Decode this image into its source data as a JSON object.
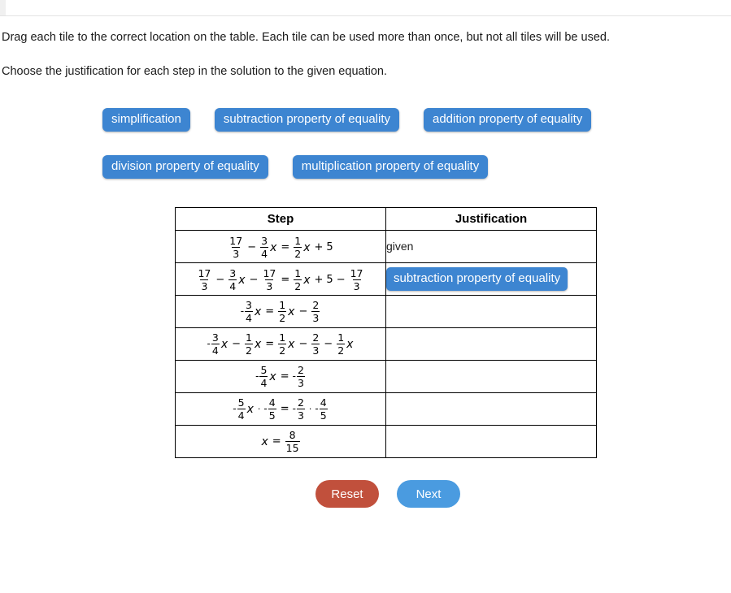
{
  "instructions": {
    "line1": "Drag each tile to the correct location on the table. Each tile can be used more than once, but not all tiles will be used.",
    "line2": "Choose the justification for each step in the solution to the given equation."
  },
  "colors": {
    "tile_blue": "#3d85d1",
    "reset_red": "#c1503c",
    "next_blue": "#4a9be0",
    "table_border": "#000000"
  },
  "tile_tray": {
    "row1": [
      {
        "label": "simplification"
      },
      {
        "label": "subtraction property of equality"
      },
      {
        "label": "addition property of equality"
      }
    ],
    "row2": [
      {
        "label": "division property of equality"
      },
      {
        "label": "multiplication property of equality"
      }
    ]
  },
  "table": {
    "headers": {
      "step": "Step",
      "justification": "Justification"
    },
    "rows": [
      {
        "step_plain": "17/3 - 3/4 x = 1/2 x + 5",
        "justification": "given",
        "justification_type": "text"
      },
      {
        "step_plain": "17/3 - 3/4 x - 17/3 = 1/2 x + 5 - 17/3",
        "justification": "subtraction property of equality",
        "justification_type": "tile"
      },
      {
        "step_plain": "-3/4 x = 1/2 x - 2/3",
        "justification": "",
        "justification_type": "empty"
      },
      {
        "step_plain": "-3/4 x - 1/2 x = 1/2 x - 2/3 - 1/2 x",
        "justification": "",
        "justification_type": "empty"
      },
      {
        "step_plain": "-5/4 x = -2/3",
        "justification": "",
        "justification_type": "empty"
      },
      {
        "step_plain": "-5/4 x · -4/5 = -2/3 · -4/5",
        "justification": "",
        "justification_type": "empty"
      },
      {
        "step_plain": "x = 8/15",
        "justification": "",
        "justification_type": "empty"
      }
    ]
  },
  "buttons": {
    "reset": "Reset",
    "next": "Next"
  }
}
